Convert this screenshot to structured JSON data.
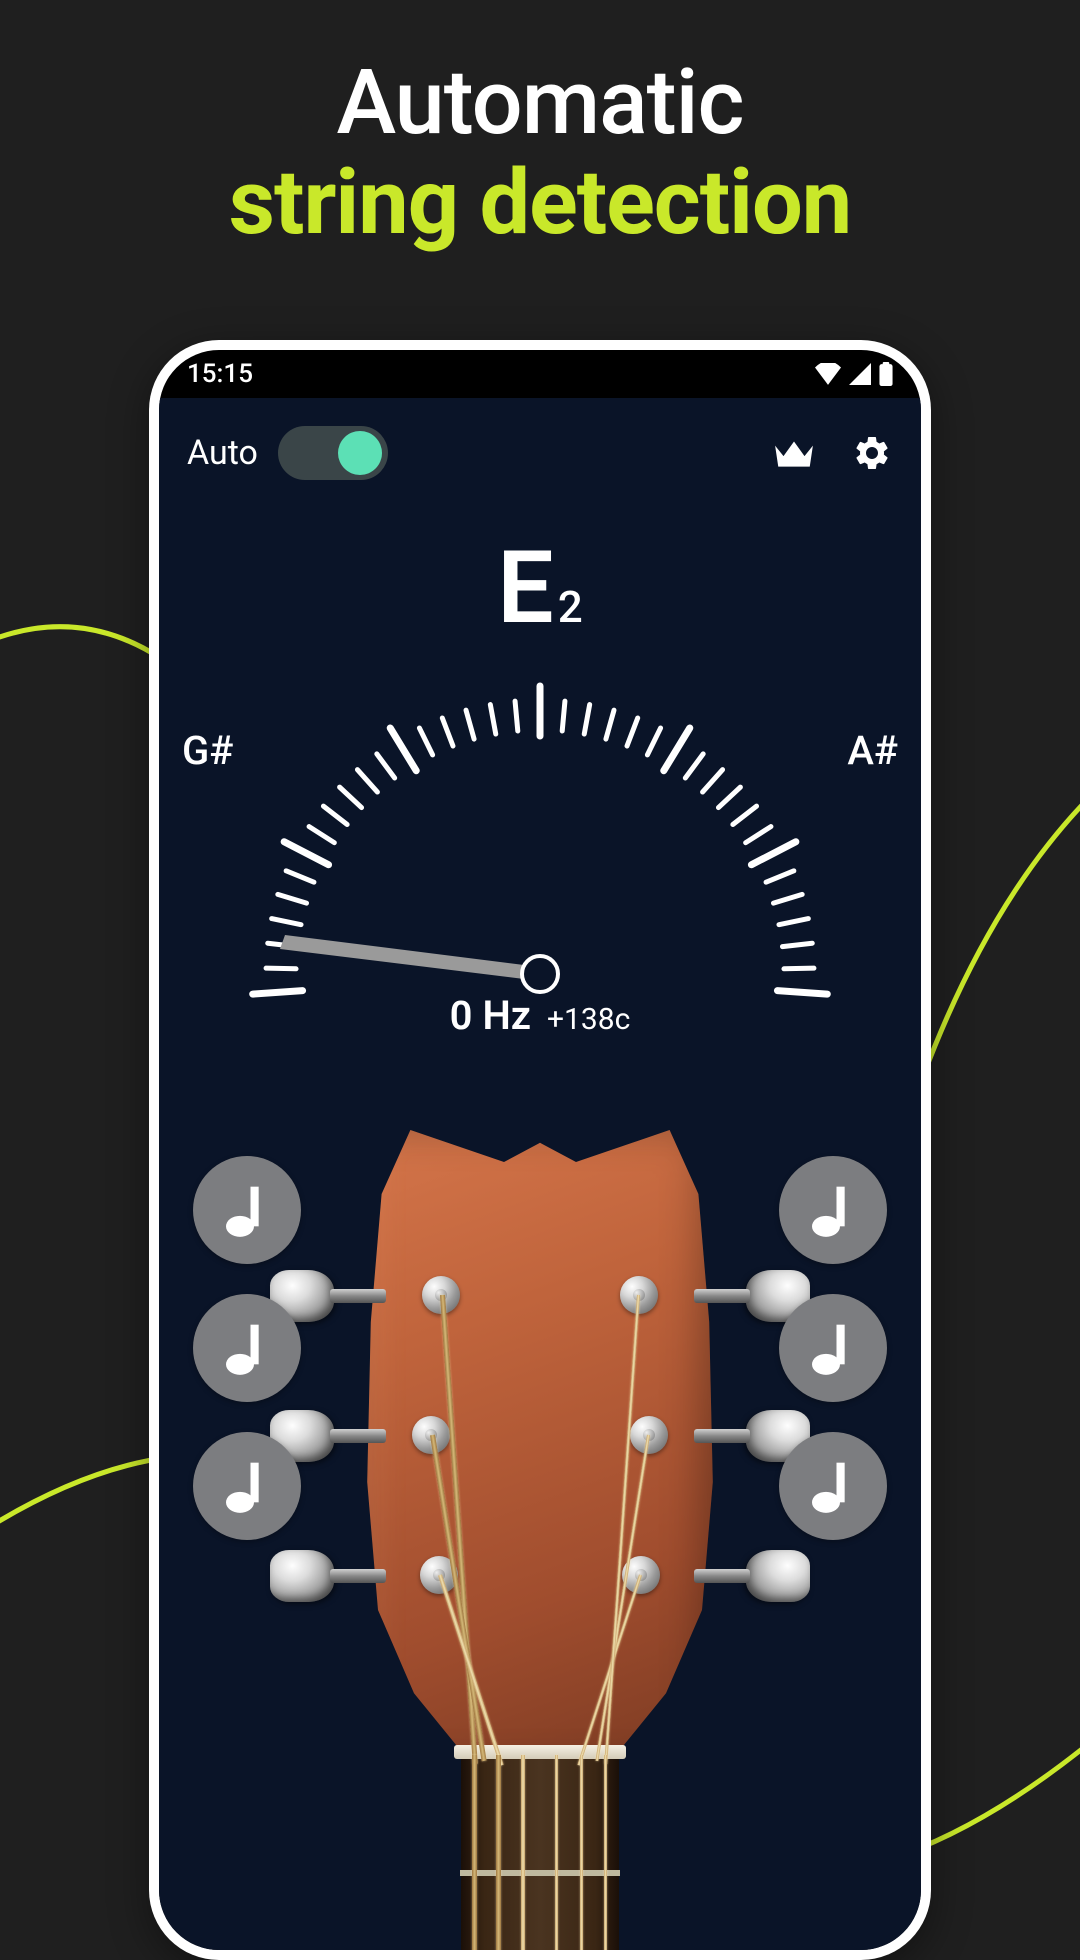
{
  "marketing": {
    "headline_top": "Automatic",
    "headline_bottom": "string detection"
  },
  "statusbar": {
    "time": "15:15"
  },
  "topbar": {
    "auto_label": "Auto",
    "auto_on": true
  },
  "tuner": {
    "note": "E",
    "octave": "2",
    "left_note": "G#",
    "right_note": "A#",
    "frequency": "0 Hz",
    "cents": "+138c"
  },
  "string_buttons": {
    "left": [
      "string-1",
      "string-2",
      "string-3"
    ],
    "right": [
      "string-4",
      "string-5",
      "string-6"
    ]
  },
  "colors": {
    "accent": "#c9e82a",
    "toggle_thumb": "#5ce0b5",
    "app_bg": "#0a1428"
  }
}
